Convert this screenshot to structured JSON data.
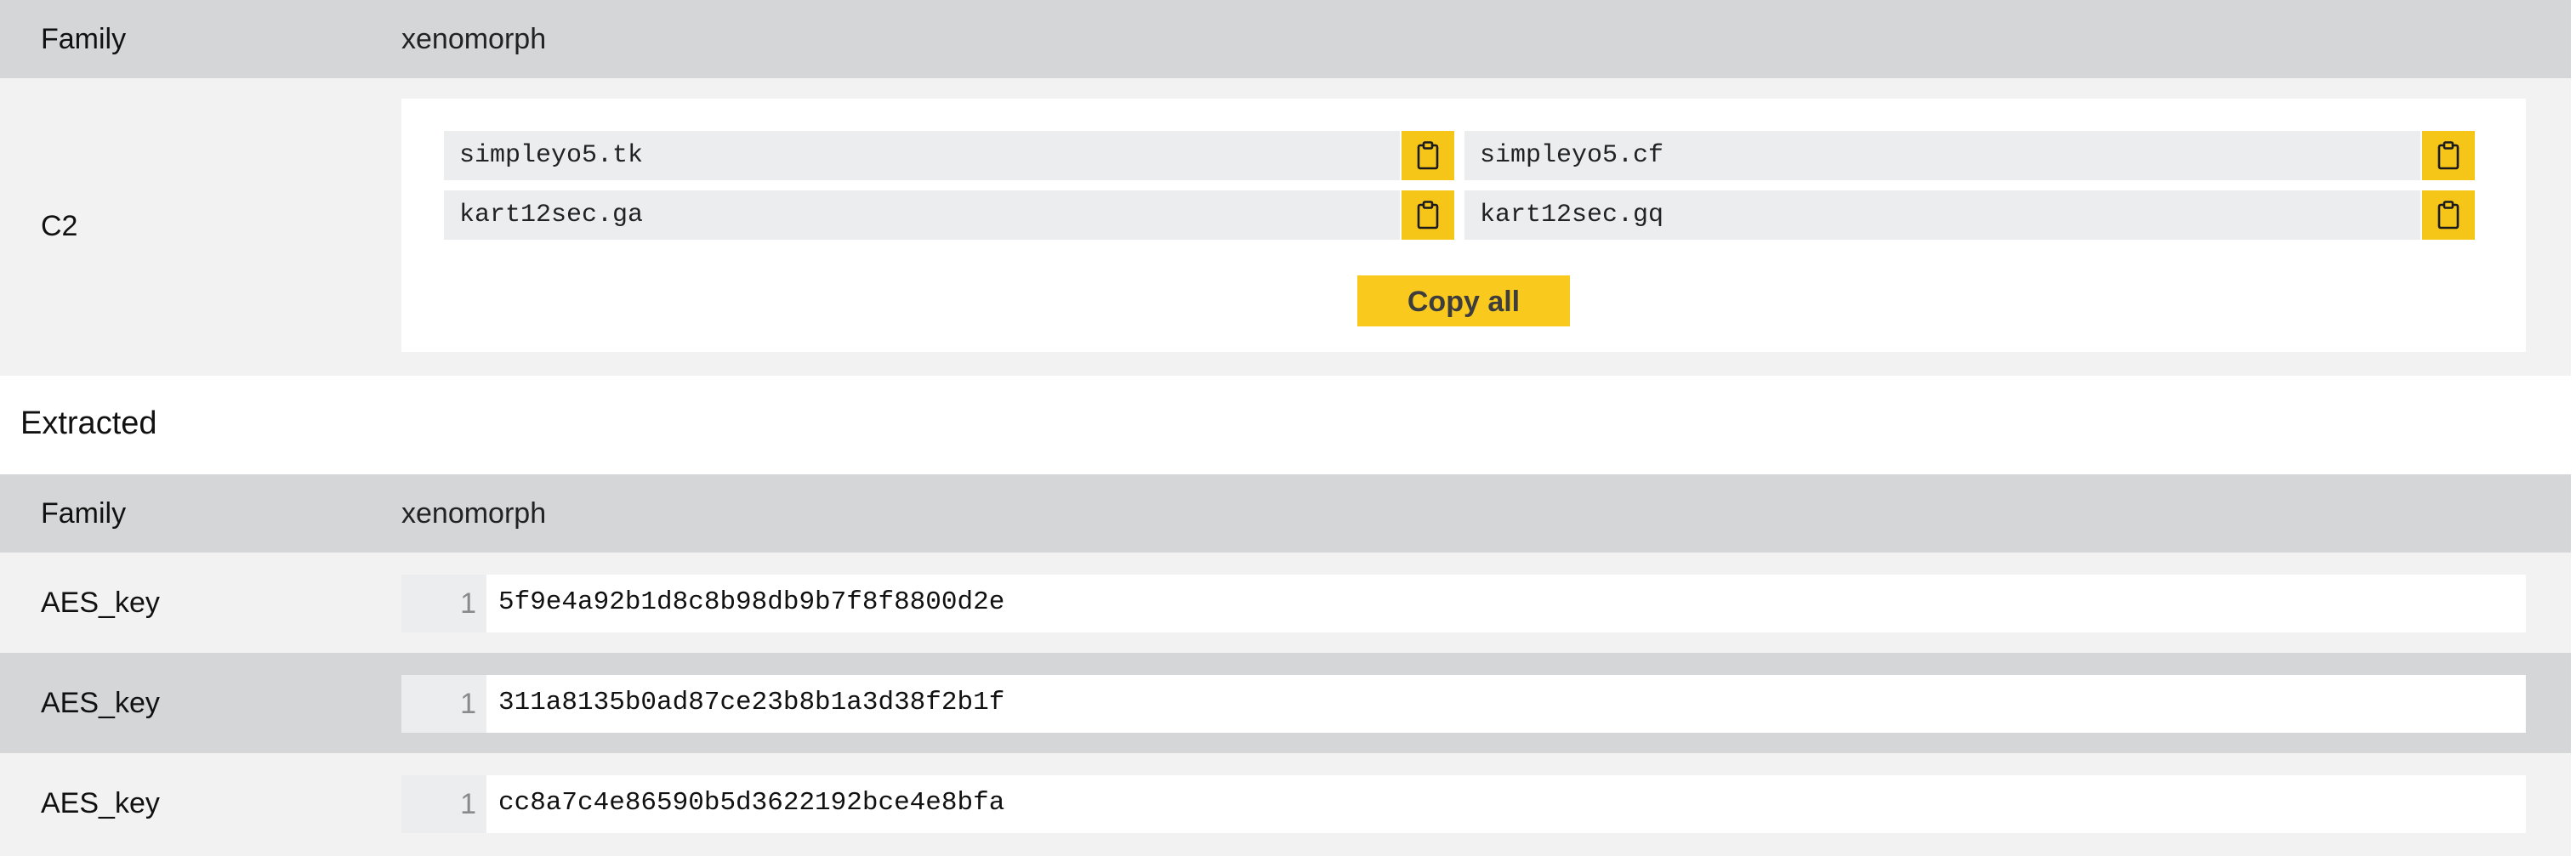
{
  "config": {
    "family_label": "Family",
    "family_value": "xenomorph",
    "c2_label": "C2",
    "c2_entries": [
      "simpleyo5.tk",
      "simpleyo5.cf",
      "kart12sec.ga",
      "kart12sec.gq"
    ],
    "copy_all_label": "Copy all",
    "copy_icon": "clipboard-icon"
  },
  "extracted": {
    "title": "Extracted",
    "family_label": "Family",
    "family_value": "xenomorph",
    "aes_keys": [
      {
        "label": "AES_key",
        "line": "1",
        "value": "5f9e4a92b1d8c8b98db9b7f8f8800d2e"
      },
      {
        "label": "AES_key",
        "line": "1",
        "value": "311a8135b0ad87ce23b8b1a3d38f2b1f"
      },
      {
        "label": "AES_key",
        "line": "1",
        "value": "cc8a7c4e86590b5d3622192bce4e8bfa"
      }
    ]
  },
  "colors": {
    "accent": "#f5c518",
    "row_dark": "#d5d6d8",
    "row_light": "#f2f2f2"
  }
}
